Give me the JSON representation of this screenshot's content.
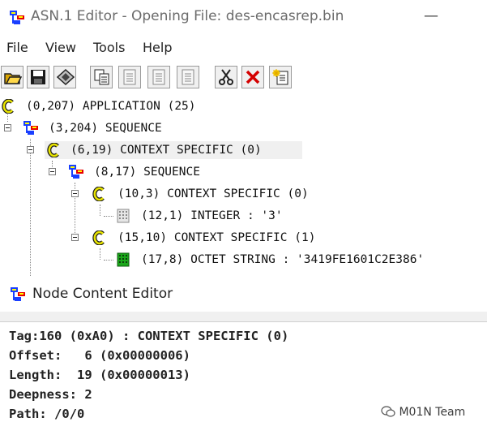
{
  "window": {
    "title": "ASN.1 Editor - Opening File: des-encasrep.bin",
    "minimize_glyph": "—"
  },
  "menu": [
    "File",
    "View",
    "Tools",
    "Help"
  ],
  "toolbar": {
    "buttons": [
      "open-icon",
      "save-icon",
      "stamp-icon",
      "copy-icon",
      "doc-icon",
      "doc-icon",
      "doc-icon",
      "cut-icon",
      "delete-icon",
      "new-doc-icon"
    ]
  },
  "tree": {
    "nodes": [
      {
        "label": "(0,207) APPLICATION (25)",
        "icon": "c-icon"
      },
      {
        "label": "(3,204) SEQUENCE",
        "icon": "sequence-icon"
      },
      {
        "label": "(6,19) CONTEXT SPECIFIC (0)",
        "icon": "c-icon"
      },
      {
        "label": "(8,17) SEQUENCE",
        "icon": "sequence-icon"
      },
      {
        "label": "(10,3) CONTEXT SPECIFIC (0)",
        "icon": "c-icon"
      },
      {
        "label": "(12,1) INTEGER : '3'",
        "icon": "integer-icon"
      },
      {
        "label": "(15,10) CONTEXT SPECIFIC (1)",
        "icon": "c-icon"
      },
      {
        "label": "(17,8) OCTET STRING : '3419FE1601C2E386'",
        "icon": "octet-string-icon"
      }
    ],
    "colors": {
      "c_icon": "#e8e400",
      "sequence_blue": "#1a3fff",
      "sequence_red": "#e60000",
      "octet_green": "#1aa81a",
      "selected_bg": "#f0f0f0"
    }
  },
  "node_editor": {
    "title": "Node Content Editor",
    "lines": [
      "Tag:160 (0xA0) : CONTEXT SPECIFIC (0)",
      "Offset:   6 (0x00000006)",
      "Length:  19 (0x00000013)",
      "Deepness: 2",
      "Path: /0/0"
    ]
  },
  "watermark": "M01N Team"
}
